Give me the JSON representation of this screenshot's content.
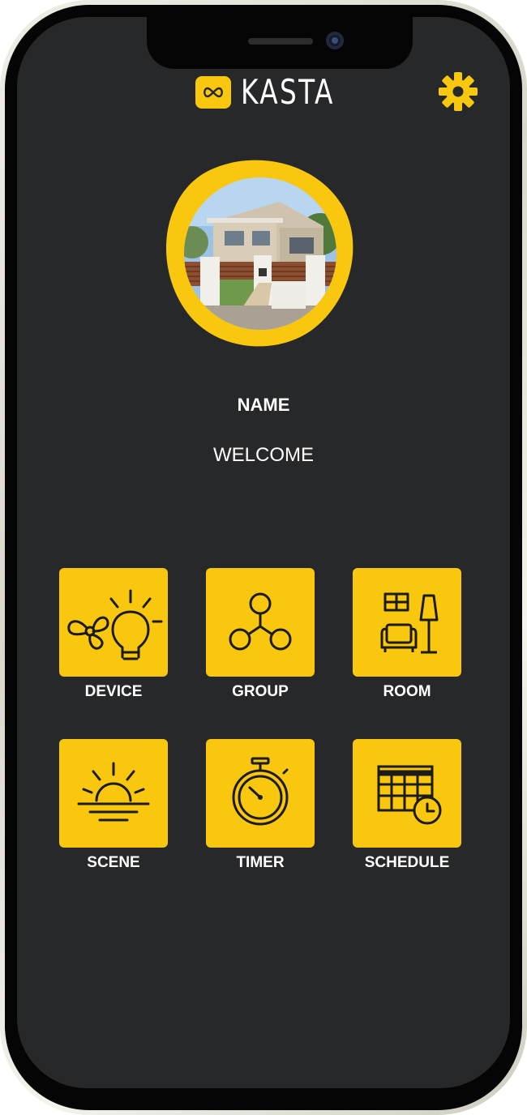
{
  "header": {
    "brand": "KASTA"
  },
  "profile": {
    "name": "NAME",
    "welcome": "WELCOME"
  },
  "menu": {
    "items": [
      {
        "label": "DEVICE",
        "icon": "fan-bulb-icon"
      },
      {
        "label": "GROUP",
        "icon": "group-nodes-icon"
      },
      {
        "label": "ROOM",
        "icon": "room-furniture-icon"
      },
      {
        "label": "SCENE",
        "icon": "sunrise-icon"
      },
      {
        "label": "TIMER",
        "icon": "stopwatch-icon"
      },
      {
        "label": "SCHEDULE",
        "icon": "calendar-clock-icon"
      }
    ]
  },
  "colors": {
    "accent": "#f9c80e",
    "background": "#27282a",
    "text": "#ffffff"
  }
}
